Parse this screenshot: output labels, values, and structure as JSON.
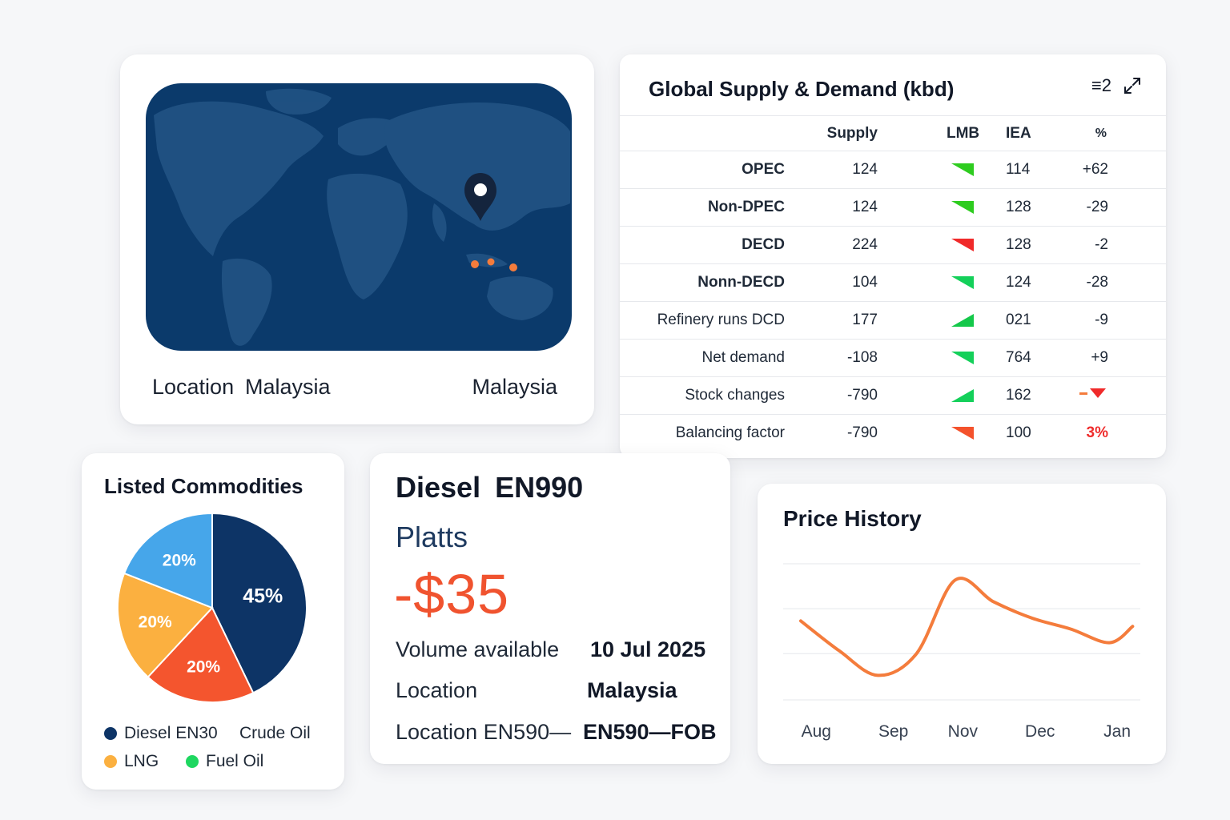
{
  "map_card": {
    "location_label": "Location",
    "location_value": "Malaysia",
    "location_right": "Malaysia"
  },
  "supply_table": {
    "title": "Global Supply & Demand (kbd)",
    "list_icon_label": "≡2",
    "columns": {
      "name": "",
      "supply": "Supply",
      "lmb": "LMB",
      "iea": "IEA",
      "pct": "%"
    },
    "rows": [
      {
        "name": "OPEC",
        "supply": "124",
        "lmb_direction": "down",
        "lmb_color": "#2ecc1f",
        "iea": "114",
        "pct": "+62",
        "bold": true
      },
      {
        "name": "Non-DPEC",
        "supply": "124",
        "lmb_direction": "down",
        "lmb_color": "#2ecc1f",
        "iea": "128",
        "pct": "-29",
        "bold": true
      },
      {
        "name": "DECD",
        "supply": "224",
        "lmb_direction": "down",
        "lmb_color": "#f02a2a",
        "iea": "128",
        "pct": "-2",
        "bold": true
      },
      {
        "name": "Nonn-DECD",
        "supply": "104",
        "lmb_direction": "down",
        "lmb_color": "#14d05a",
        "iea": "124",
        "pct": "-28",
        "bold": true
      },
      {
        "name": "Refinery runs DCD",
        "supply": "177",
        "lmb_direction": "up",
        "lmb_color": "#14c84a",
        "iea": "021",
        "pct": "-9",
        "bold": false
      },
      {
        "name": "Net demand",
        "supply": "-108",
        "lmb_direction": "down",
        "lmb_color": "#14d05a",
        "iea": "764",
        "pct": "+9",
        "bold": false
      },
      {
        "name": "Stock changes",
        "supply": "-790",
        "lmb_direction": "up",
        "lmb_color": "#14d05a",
        "iea": "162",
        "pct": "",
        "pct_icon": "dash-down-triangle-icon",
        "bold": false
      },
      {
        "name": "Balancing factor",
        "supply": "-790",
        "lmb_direction": "down",
        "lmb_color": "#f4522c",
        "iea": "100",
        "pct": "3%",
        "pct_red": true,
        "bold": false
      }
    ]
  },
  "commodities": {
    "title": "Listed Commodities",
    "legend": [
      {
        "label": "Diesel EN30",
        "color": "#0d3466",
        "dot": true
      },
      {
        "label": "Crude Oil",
        "color": "",
        "dot": false
      },
      {
        "label": "LNG",
        "color": "#fbb040",
        "dot": true
      },
      {
        "label": "Fuel Oil",
        "color": "#1ed760",
        "dot": true
      }
    ]
  },
  "diesel": {
    "title": "Diesel EN990",
    "source": "Platts",
    "price": "-$35",
    "volume_label": "Volume available",
    "volume_value": "10 Jul 2025",
    "location_label": "Location",
    "location_value": "Malaysia",
    "location2_label": "Location EN590—",
    "location2_value": "EN590—FOB"
  },
  "price_history": {
    "title": "Price History"
  },
  "chart_data": [
    {
      "type": "pie",
      "title": "Listed Commodities",
      "slices": [
        {
          "label": "45%",
          "value": 45,
          "color": "#0d3466"
        },
        {
          "label": "20%",
          "value": 20,
          "color": "#f4552e"
        },
        {
          "label": "20%",
          "value": 20,
          "color": "#fbb040"
        },
        {
          "label": "20%",
          "value": 20,
          "color": "#46a6ea"
        }
      ]
    },
    {
      "type": "line",
      "title": "Price History",
      "categories": [
        "Aug",
        "Sep",
        "Nov",
        "Dec",
        "Jan"
      ],
      "x": [
        0,
        0.5,
        1,
        1.5,
        2,
        2.5,
        3,
        3.5,
        4,
        4.3
      ],
      "values": [
        58,
        36,
        18,
        34,
        88,
        72,
        60,
        52,
        42,
        54
      ],
      "ylim": [
        0,
        100
      ],
      "color": "#f47c3c",
      "grid": true
    }
  ]
}
